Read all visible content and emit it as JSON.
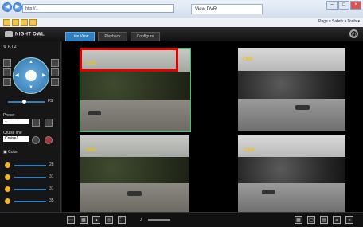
{
  "browser": {
    "address": "http://...",
    "tab_title": "View DVR",
    "menu": "Page ▾  Safety ▾  Tools ▾"
  },
  "app": {
    "logo": "NIGHT OWL",
    "tabs": [
      "Live View",
      "Playback",
      "Configure"
    ],
    "left": {
      "ptz_label": "P.T.Z",
      "preset_label": "Preset",
      "preset_value": "1",
      "cruise_label": "Cruise line",
      "cruise_value": "Cruise1",
      "color_label": "Color",
      "zoom_value": "FS",
      "color_values": [
        "28",
        "31",
        "31",
        "35"
      ]
    },
    "cameras": [
      {
        "label": "CH1"
      },
      {
        "label": "CH2"
      },
      {
        "label": "CH3"
      },
      {
        "label": "CH4"
      }
    ]
  }
}
